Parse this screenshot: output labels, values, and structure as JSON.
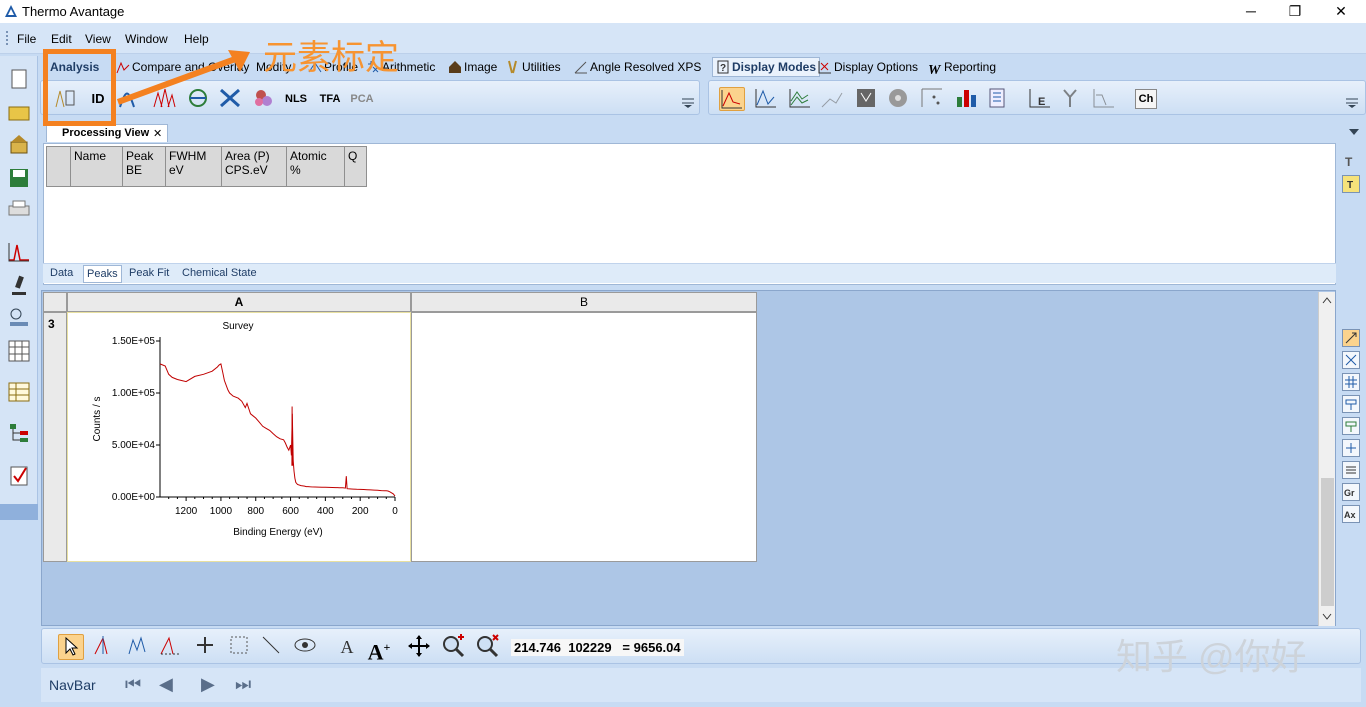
{
  "window": {
    "title": "Thermo Avantage",
    "minimize": "─",
    "maximize": "❐",
    "close": "✕"
  },
  "menu": [
    "File",
    "Edit",
    "View",
    "Window",
    "Help"
  ],
  "ribbon_tabs": [
    {
      "label": "Analysis",
      "icon": "analysis-icon"
    },
    {
      "label": "Compare and Overlay",
      "icon": "compare-icon"
    },
    {
      "label": "Modify",
      "icon": "modify-icon"
    },
    {
      "label": "Profile",
      "icon": "profile-icon"
    },
    {
      "label": "Arithmetic",
      "icon": "arithmetic-icon"
    },
    {
      "label": "Image",
      "icon": "image-icon"
    },
    {
      "label": "Utilities",
      "icon": "utilities-icon"
    },
    {
      "label": "Angle Resolved XPS",
      "icon": "angle-icon"
    },
    {
      "label": "Display Modes",
      "icon": "display-modes-icon"
    },
    {
      "label": "Display Options",
      "icon": "display-options-icon"
    },
    {
      "label": "Reporting",
      "icon": "reporting-icon"
    }
  ],
  "toolbar_analysis": {
    "id": "ID",
    "nls": "NLS",
    "tfa": "TFA",
    "pca": "PCA"
  },
  "toolbar_display": {
    "ch": "Ch"
  },
  "processing_view": {
    "tab_label": "Processing View",
    "close": "✕"
  },
  "peaks_table": {
    "headers": [
      "",
      "Name",
      "Peak\nBE",
      "FWHM\neV",
      "Area (P)\nCPS.eV",
      "Atomic\n%",
      "Q"
    ]
  },
  "sub_tabs": [
    "Data",
    "Peaks",
    "Peak Fit",
    "Chemical State"
  ],
  "grid": {
    "columns": [
      "A",
      "B"
    ],
    "row": "3"
  },
  "chart_data": {
    "type": "line",
    "title": "Survey",
    "xlabel": "Binding Energy (eV)",
    "ylabel": "Counts / s",
    "xlim": [
      1350,
      0
    ],
    "ylim": [
      0,
      150000
    ],
    "x_ticks": [
      "1200",
      "1000",
      "800",
      "600",
      "400",
      "200",
      "0"
    ],
    "y_ticks": [
      "0.00E+00",
      "5.00E+04",
      "1.00E+05",
      "1.50E+05"
    ],
    "series": [
      {
        "color": "#c00000",
        "x": [
          1350,
          1320,
          1300,
          1280,
          1250,
          1200,
          1150,
          1100,
          1050,
          1020,
          1010,
          1000,
          990,
          980,
          960,
          950,
          930,
          900,
          880,
          860,
          850,
          830,
          800,
          780,
          760,
          740,
          720,
          700,
          680,
          660,
          640,
          630,
          620,
          610,
          600,
          595,
          590,
          585,
          580,
          575,
          570,
          560,
          540,
          520,
          510,
          500,
          490,
          480,
          460,
          440,
          420,
          400,
          380,
          360,
          340,
          330,
          320,
          300,
          285,
          280,
          275,
          260,
          240,
          220,
          200,
          180,
          160,
          140,
          120,
          100,
          80,
          60,
          50,
          40,
          30,
          20,
          10,
          5,
          0
        ],
        "y": [
          128000,
          126000,
          118000,
          115000,
          113000,
          111000,
          116000,
          118000,
          121000,
          125000,
          127000,
          128000,
          120000,
          112000,
          103000,
          100000,
          97000,
          95000,
          92000,
          86000,
          90000,
          80000,
          76000,
          72000,
          68000,
          66000,
          64000,
          61000,
          58000,
          56000,
          55000,
          52000,
          48000,
          45000,
          50000,
          40000,
          80000,
          35000,
          25000,
          18000,
          14000,
          12000,
          11000,
          10500,
          10000,
          10000,
          9800,
          9700,
          9600,
          9500,
          9400,
          9300,
          9200,
          9100,
          9000,
          9000,
          8900,
          8800,
          8600,
          20000,
          8000,
          7800,
          7600,
          7400,
          7300,
          7200,
          7000,
          6800,
          6600,
          6400,
          6200,
          6000,
          6000,
          5800,
          5000,
          4000,
          3000,
          2000,
          1000
        ]
      },
      {
        "color": "#c00000",
        "x": [
          592,
          591,
          590,
          589,
          588
        ],
        "y": [
          30000,
          87000,
          60000,
          50000,
          30000
        ]
      }
    ]
  },
  "bottom_toolbar": {
    "coords": "214.746  102229   = 9656.04"
  },
  "navbar": {
    "label": "NavBar"
  },
  "annotation": {
    "text": "元素标定",
    "color": "#f48120"
  },
  "watermark": "知乎 @你好"
}
